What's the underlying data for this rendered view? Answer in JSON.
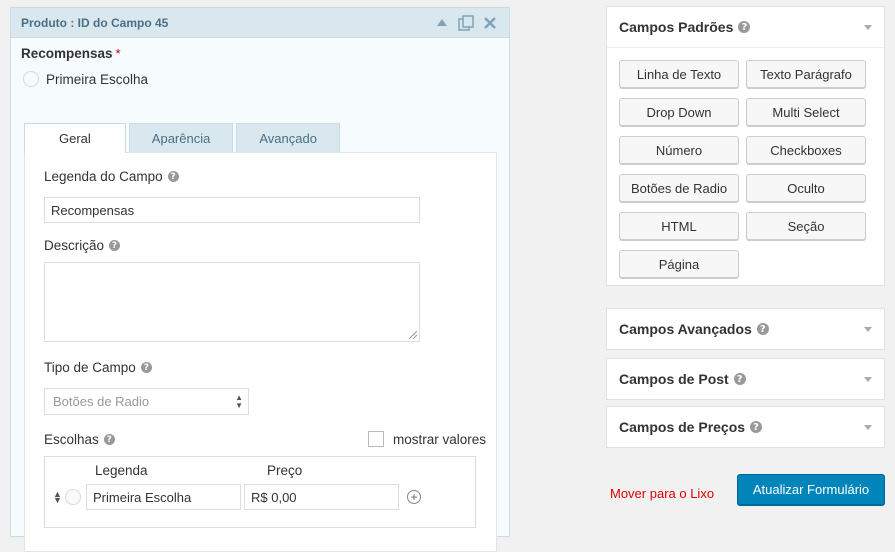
{
  "field_editor": {
    "header_title": "Produto : ID do Campo 45",
    "preview_label": "Recompensas",
    "required_mark": "*",
    "preview_choice": "Primeira Escolha",
    "tabs": [
      {
        "label": "Geral",
        "active": true
      },
      {
        "label": "Aparência",
        "active": false
      },
      {
        "label": "Avançado",
        "active": false
      }
    ],
    "caption_label": "Legenda do Campo",
    "caption_value": "Recompensas",
    "description_label": "Descrição",
    "description_value": "",
    "field_type_label": "Tipo de Campo",
    "field_type_value": "Botões de Radio",
    "choices_label": "Escolhas",
    "show_values_label": "mostrar valores",
    "show_values_checked": false,
    "choices_col_legend": "Legenda",
    "choices_col_price": "Preço",
    "choices": [
      {
        "label": "Primeira Escolha",
        "price": "R$ 0,00"
      }
    ]
  },
  "sidebar": {
    "standard": {
      "title": "Campos Padrões",
      "buttons": [
        "Linha de Texto",
        "Texto Parágrafo",
        "Drop Down",
        "Multi Select",
        "Número",
        "Checkboxes",
        "Botões de Radio",
        "Oculto",
        "HTML",
        "Seção",
        "Página"
      ]
    },
    "advanced_title": "Campos Avançados",
    "post_title": "Campos de Post",
    "pricing_title": "Campos de Preços"
  },
  "actions": {
    "trash_label": "Mover para o Lixo",
    "update_label": "Atualizar Formulário"
  },
  "colors": {
    "primary": "#0085ba",
    "danger": "#dd0000",
    "header_bg": "#d9e8ef"
  }
}
